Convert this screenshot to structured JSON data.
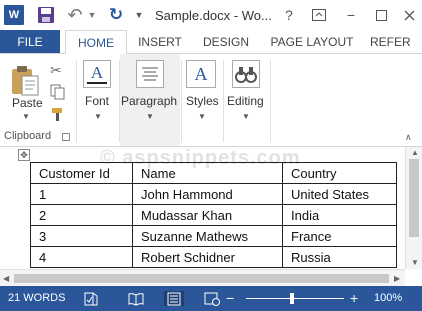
{
  "window": {
    "title": "Sample.docx - Wo...",
    "app_logo": "W",
    "help_glyph": "?",
    "restore_glyph": "▭",
    "minimize_glyph": "−",
    "maximize_glyph": "☐"
  },
  "qat": {
    "save_icon": "save-icon",
    "undo_icon": "undo-icon",
    "redo_icon": "redo-icon"
  },
  "tabs": {
    "file": "FILE",
    "home": "HOME",
    "insert": "INSERT",
    "design": "DESIGN",
    "page_layout": "PAGE LAYOUT",
    "references": "REFER"
  },
  "ribbon": {
    "paste_label": "Paste",
    "clipboard_label": "Clipboard",
    "font_label": "Font",
    "paragraph_label": "Paragraph",
    "styles_label": "Styles",
    "editing_label": "Editing",
    "font_glyph": "A",
    "styles_glyph": "A"
  },
  "document": {
    "watermark": "© aspsnippets.com",
    "table": {
      "headers": [
        "Customer Id",
        "Name",
        "Country"
      ],
      "rows": [
        [
          "1",
          "John Hammond",
          "United States"
        ],
        [
          "2",
          "Mudassar Khan",
          "India"
        ],
        [
          "3",
          "Suzanne Mathews",
          "France"
        ],
        [
          "4",
          "Robert Schidner",
          "Russia"
        ]
      ]
    }
  },
  "status": {
    "words": "21 WORDS",
    "zoom_out": "−",
    "zoom_in": "+",
    "zoom": "100%",
    "zoom_level": 1.0
  },
  "colors": {
    "brand": "#2b579a",
    "ribbon_hover": "#f0f0f0"
  }
}
